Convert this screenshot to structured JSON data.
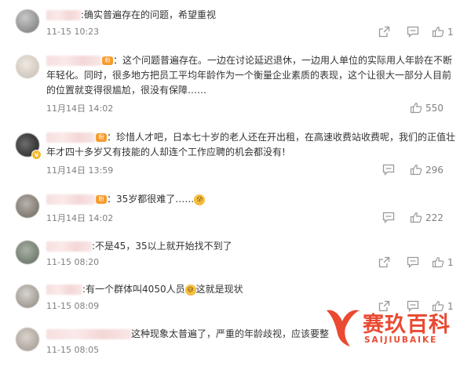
{
  "comments": [
    {
      "text": ":确实普遍存在的问题，希望重视",
      "time": "11-15 10:23",
      "likes": "1"
    },
    {
      "text": "：这个问题普遍存在。一边在讨论延迟退休，一边用人单位的实际用人年龄在不断年轻化。同时，很多地方把员工平均年龄作为一个衡量企业素质的表现，这个让很大一部分人目前的位置就变得很尴尬，很没有保障……",
      "time": "11月14日 14:02",
      "likes": "550"
    },
    {
      "text": "：珍惜人才吧，日本七十岁的老人还在开出租，在高速收费站收费呢，我们的正值壮年才四十多岁又有技能的人却连个工作应聘的机会都没有!",
      "time": "11月14日 13:59",
      "likes": "296"
    },
    {
      "text": "：35岁都很难了……",
      "time": "11月14日 14:02",
      "likes": "222"
    },
    {
      "text": ":不是45，35以上就开始找不到了",
      "time": "11-15 08:20",
      "likes": "1"
    },
    {
      "text_a": ":有一个群体叫4050人员",
      "text_b": "这就是现状",
      "time": "11-15 08:09",
      "likes": "1"
    },
    {
      "text": "这种现象太普遍了，严重的年龄歧视，应该要整",
      "time": "11-15 08:05",
      "likes": ""
    }
  ],
  "watermark": {
    "cn": "赛玖百科",
    "en": "SAIJIUBAIKE",
    "color": "#ea4a32"
  },
  "icons": [
    "share-icon",
    "comment-icon",
    "like-icon"
  ],
  "colors": {
    "text": "#333333",
    "meta": "#808080",
    "accent": "#f79b2c"
  }
}
